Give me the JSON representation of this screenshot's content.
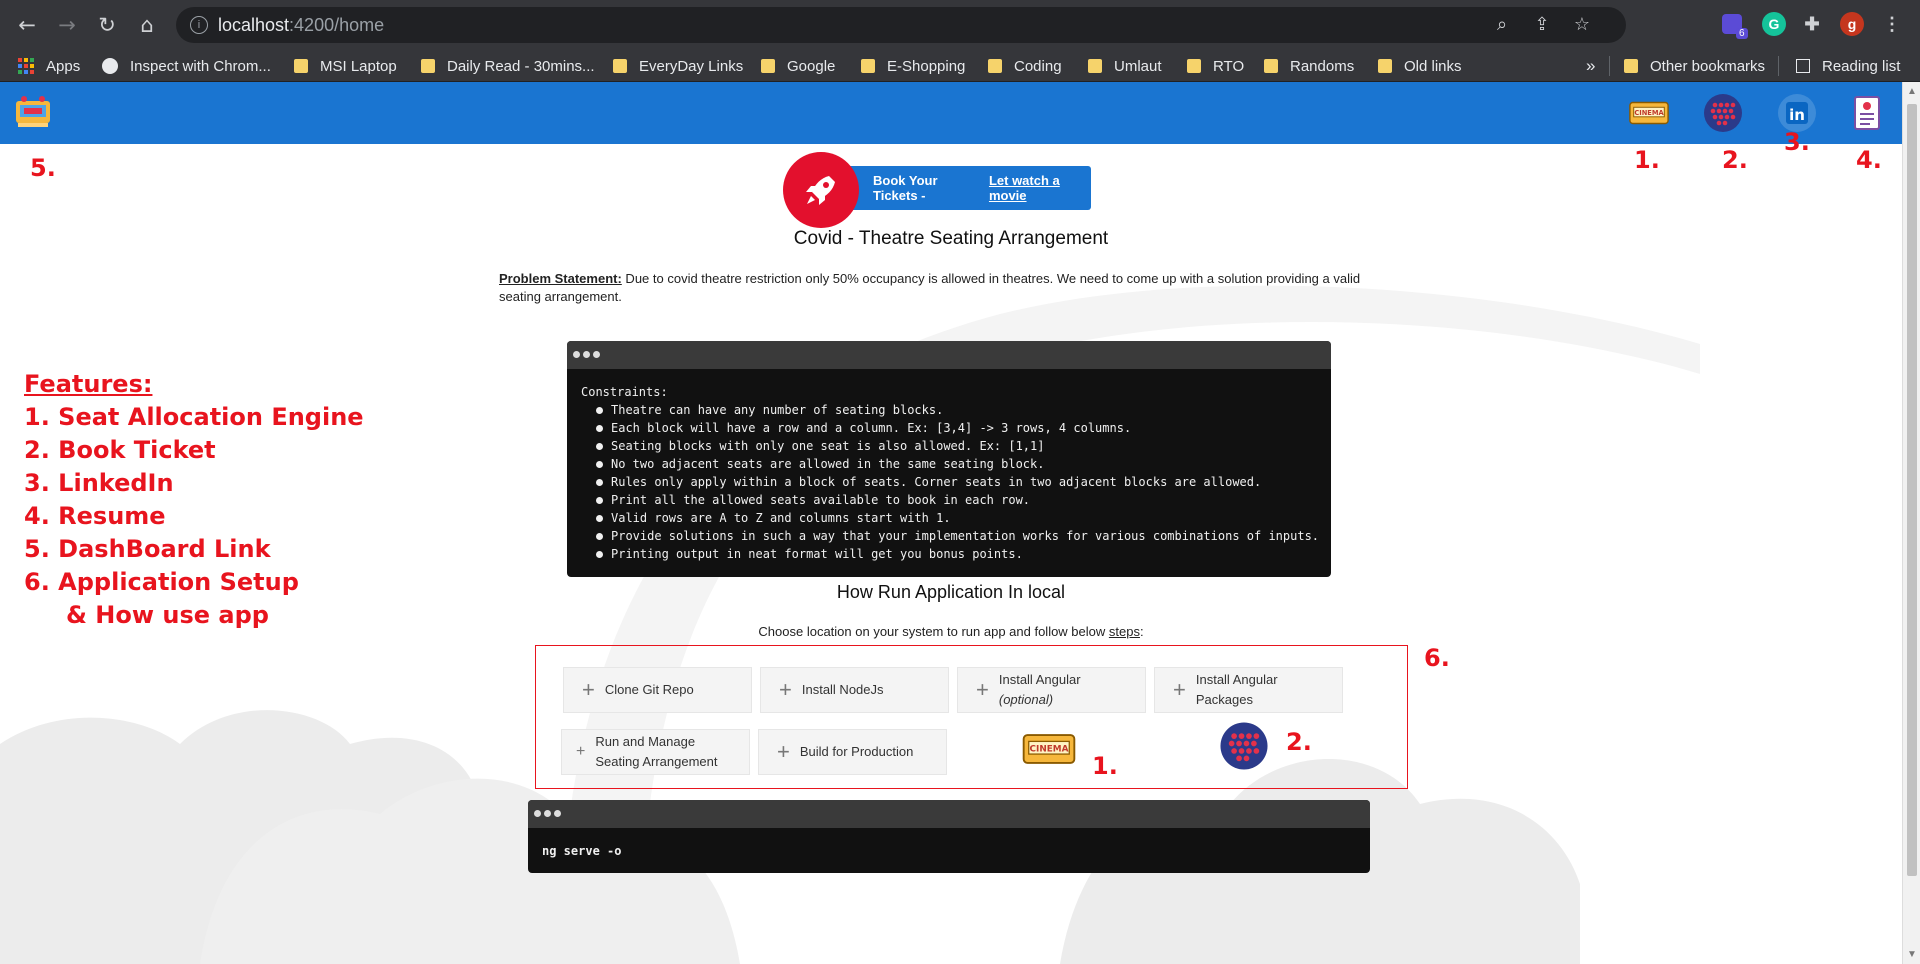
{
  "browser": {
    "url_host": "localhost",
    "url_path": ":4200/home",
    "extension_badge": "6",
    "profile_initial": "g",
    "bookmarks": [
      {
        "label": "Apps",
        "type": "apps"
      },
      {
        "label": "Inspect with Chrom...",
        "type": "globe"
      },
      {
        "label": "MSI Laptop",
        "type": "folder"
      },
      {
        "label": "Daily Read - 30mins...",
        "type": "folder"
      },
      {
        "label": "EveryDay Links",
        "type": "folder"
      },
      {
        "label": "Google",
        "type": "folder"
      },
      {
        "label": "E-Shopping",
        "type": "folder"
      },
      {
        "label": "Coding",
        "type": "folder"
      },
      {
        "label": "Umlaut",
        "type": "folder"
      },
      {
        "label": "RTO",
        "type": "folder"
      },
      {
        "label": "Randoms",
        "type": "folder"
      },
      {
        "label": "Old links",
        "type": "folder"
      }
    ],
    "overflow": "»",
    "other_bookmarks": "Other bookmarks",
    "reading_list": "Reading list"
  },
  "header": {
    "logo_icon": "dashboard-logo-icon",
    "nav_icons": [
      "cinema-ticket-icon",
      "seat-grid-icon",
      "linkedin-icon",
      "resume-icon"
    ]
  },
  "annotations": {
    "n1": "1.",
    "n2": "2.",
    "n3": "3.",
    "n4": "4.",
    "n5": "5.",
    "n6": "6.",
    "steps_n1": "1.",
    "steps_n2": "2."
  },
  "features": {
    "title": "Features:",
    "items": [
      "1. Seat Allocation Engine",
      "2. Book Ticket",
      "3. LinkedIn",
      "4. Resume",
      "5. DashBoard Link",
      "6. Application Setup",
      "& How use app"
    ]
  },
  "main": {
    "book_label": "Book Your Tickets -",
    "book_link": "Let watch a movie",
    "title": "Covid - Theatre Seating Arrangement",
    "problem_label": "Problem Statement:",
    "problem_text": " Due to covid theatre restriction only 50% occupancy is allowed in theatres. We need to come up with a solution providing a valid seating arrangement.",
    "constraints_heading": "Constraints:",
    "constraints": [
      "Theatre can have any number of seating blocks.",
      "Each block will have a row and a column. Ex: [3,4] -> 3 rows, 4 columns.",
      "Seating blocks with only one seat is also allowed. Ex: [1,1]",
      "No two adjacent seats are allowed in the same seating block.",
      "Rules only apply within a block of seats. Corner seats in two adjacent blocks are allowed.",
      "Print all the allowed seats available to book in each row.",
      "Valid rows are A to Z and columns start with 1.",
      "Provide solutions in such a way that your implementation works for various combinations of inputs.",
      "Printing output in neat format will get you bonus points."
    ],
    "howrun_title": "How Run Application In local",
    "choose_text": "Choose location on your system to run app and follow below ",
    "choose_steps": "steps",
    "choose_colon": ":",
    "steps": [
      {
        "line1": "Clone Git Repo",
        "line2": ""
      },
      {
        "line1": "Install NodeJs",
        "line2": ""
      },
      {
        "line1": "Install Angular",
        "line2": "(optional)"
      },
      {
        "line1": "Install Angular",
        "line2": "Packages"
      },
      {
        "line1": "Run and Manage",
        "line2": "Seating Arrangement"
      },
      {
        "line1": "Build for Production",
        "line2": ""
      }
    ],
    "command": "ng serve -o"
  }
}
